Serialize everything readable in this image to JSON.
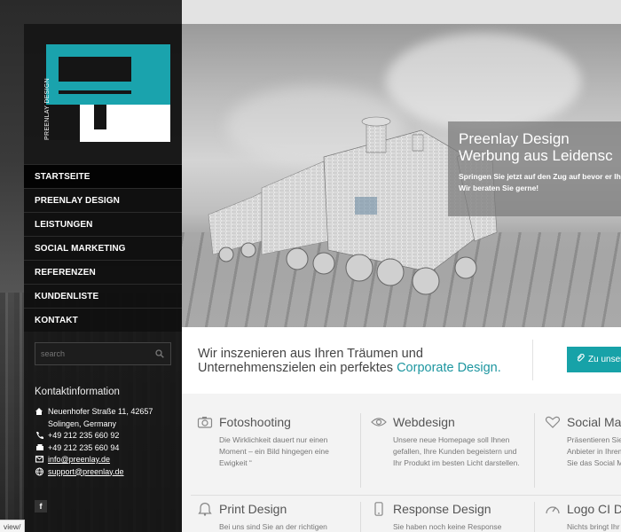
{
  "logo": {
    "brand_text": "PREENLAY DESIGN",
    "accent_color": "#1aa3ad"
  },
  "nav": {
    "items": [
      {
        "label": "STARTSEITE"
      },
      {
        "label": "PREENLAY DESIGN"
      },
      {
        "label": "LEISTUNGEN"
      },
      {
        "label": "SOCIAL MARKETING"
      },
      {
        "label": "REFERENZEN"
      },
      {
        "label": "KUNDENLISTE"
      },
      {
        "label": "KONTAKT"
      }
    ]
  },
  "search": {
    "placeholder": "search"
  },
  "contact": {
    "title": "Kontaktinformation",
    "street": "Neuenhofer Straße 11, 42657",
    "city": "Solingen, Germany",
    "phone": "+49 212 235 660 92",
    "fax": "+49 212 235 660 94",
    "email": "info@preenlay.de",
    "support": "support@preenlay.de"
  },
  "social": {
    "facebook": "f"
  },
  "hero": {
    "title_line1": "Preenlay Design",
    "title_line2": "Werbung aus Leidensc",
    "text_line1": "Springen Sie jetzt auf den Zug auf bevor er Ihne",
    "text_line2": "Wir beraten Sie gerne!"
  },
  "intro": {
    "line1": "Wir inszenieren aus Ihren Träumen und",
    "line2_plain": "Unternehmenszielen ein perfektes ",
    "line2_accent": "Corporate Design.",
    "button_label": "Zu unsere"
  },
  "services": [
    {
      "title": "Fotoshooting",
      "icon": "camera-icon",
      "text": "Die Wirklichkeit dauert nur einen Moment – ein Bild hingegen eine Ewigkeit “"
    },
    {
      "title": "Webdesign",
      "icon": "eye-icon",
      "text": "Unsere neue Homepage soll Ihnen gefallen, Ihre Kunden begeistern und Ihr Produkt im besten Licht darstellen."
    },
    {
      "title": "Social Mar",
      "icon": "heart-icon",
      "text": "Präsentieren Sie Anbieter in Ihrem Sie das Social M"
    },
    {
      "title": "Print Design",
      "icon": "bell-icon",
      "text": "Bei uns sind Sie an der richtigen"
    },
    {
      "title": "Response Design",
      "icon": "mobile-icon",
      "text": "Sie haben noch keine Response"
    },
    {
      "title": "Logo CI De",
      "icon": "gauge-icon",
      "text": "Nichts bringt Ihr"
    }
  ],
  "status_bar": {
    "text": "view/"
  }
}
